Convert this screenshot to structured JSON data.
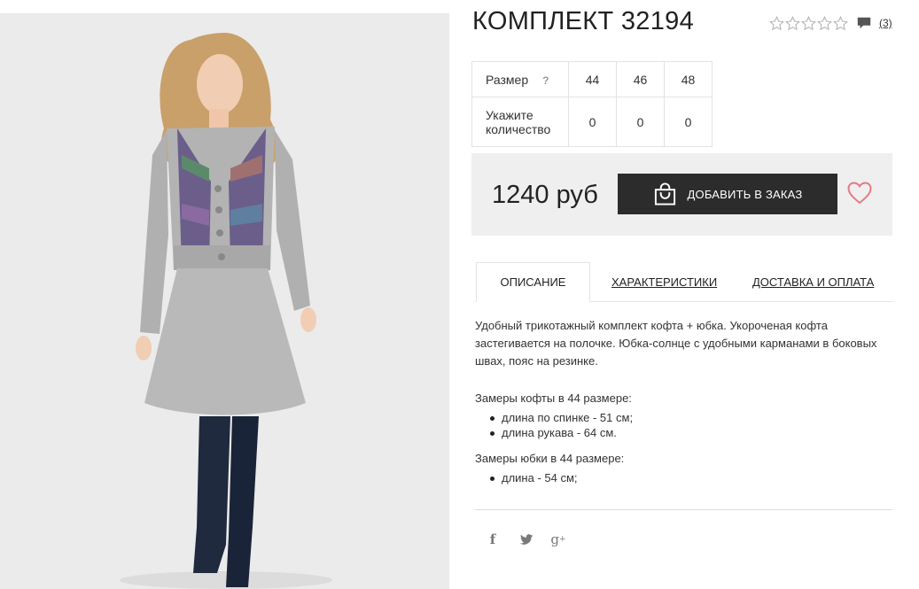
{
  "product": {
    "title": "КОМПЛЕКТ 32194",
    "rating_stars": 0,
    "reviews_count": "(3)",
    "icons": [
      "star-icon",
      "comment-icon",
      "shopping-bag-icon",
      "heart-icon",
      "facebook-icon",
      "twitter-icon",
      "google-plus-icon"
    ]
  },
  "size_table": {
    "size_label": "Размер",
    "help": "?",
    "sizes": [
      "44",
      "46",
      "48"
    ],
    "qty_label": "Укажите количество",
    "quantities": [
      "0",
      "0",
      "0"
    ]
  },
  "purchase": {
    "price": "1240 руб",
    "add_button": "ДОБАВИТЬ В ЗАКАЗ"
  },
  "tabs": [
    "ОПИСАНИЕ",
    "ХАРАКТЕРИСТИКИ",
    "ДОСТАВКА И ОПЛАТА"
  ],
  "description": {
    "text": "Удобный трикотажный комплект кофта + юбка. Укороченая кофта застегивается на полочке. Юбка-солнце с удобными карманами в боковых швах, пояс на резинке.",
    "jacket_heading": "Замеры кофты в 44 размере:",
    "jacket_items": [
      "длина по спинке - 51 см;",
      "длина рукава - 64 см."
    ],
    "skirt_heading": "Замеры юбки в 44 размере:",
    "skirt_items": [
      "длина - 54 см;"
    ]
  },
  "share": {
    "facebook": "f",
    "google_plus": "g"
  },
  "colors": {
    "accent_dark": "#2c2c2c",
    "price_bar_bg": "#efefef",
    "heart": "#e57a85"
  }
}
